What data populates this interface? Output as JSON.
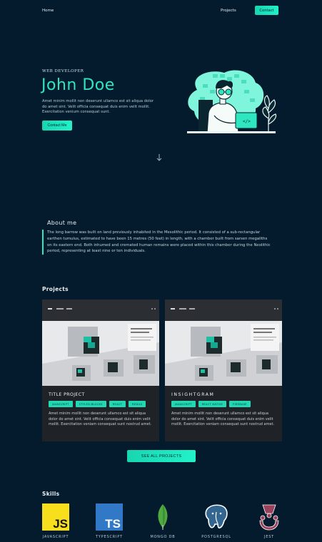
{
  "nav": {
    "home": "Home",
    "projects": "Projects",
    "contact": "Contact"
  },
  "hero": {
    "kicker": "WEB DEVELOPER",
    "name": "John Doe",
    "text": "Amet minim mollit non deserunt ullamco est sit aliqua dolor do amet sint. Velit officia consequat duis enim velit mollit. Exercitation venium consequat sunt.",
    "button": "Contact Me"
  },
  "about": {
    "title": "About me",
    "body": "The long barrow was built on land previously inhabited in the Mesolithic period. It consisted of a sub-rectangular earthen tumulus, estimated to have been 15 metres (50 feet) in length, with a chamber built from sarsen megaliths on its eastern end. Both inhumed and cremated human remains were placed within this chamber during the Neolithic period, representing at least nine or ten individuals."
  },
  "projects": {
    "title": "Projects",
    "see_all": "SEE ALL PROJECTS",
    "items": [
      {
        "title": "TITLE PROJECT",
        "tags": [
          "JAVASCRIPT",
          "STYLED-BLOCKS",
          "REACT",
          "REDUX"
        ],
        "text": "Amet minim mollit non deserunt ullamco est sit aliqua dolor do amet sint. Velit officia consequat duis enim velit mollit. Exercitation veniam consequat sunt nostrud amet."
      },
      {
        "title": "INSIGHTGRAM",
        "tags": [
          "JAVASCRIPT",
          "REACT NATIVE",
          "FIREBASE"
        ],
        "text": "Amet minim mollit non deserunt ullamco est sit aliqua dolor do amet sint. Velit officia consequat duis enim velit mollit. Exercitation veniam consequat sunt nostrud amet."
      }
    ]
  },
  "skills": {
    "title": "Skills",
    "items": [
      {
        "label": "JAVASCRIPT",
        "icon": "javascript-logo-icon"
      },
      {
        "label": "TYPESCRIPT",
        "icon": "typescript-logo-icon"
      },
      {
        "label": "MONGO DB",
        "icon": "mongodb-logo-icon"
      },
      {
        "label": "POSTGRESQL",
        "icon": "postgresql-logo-icon"
      },
      {
        "label": "JEST",
        "icon": "jest-logo-icon"
      }
    ]
  },
  "colors": {
    "background": "#041b2d",
    "accent": "#2ee6c0",
    "card": "#1f2226"
  }
}
